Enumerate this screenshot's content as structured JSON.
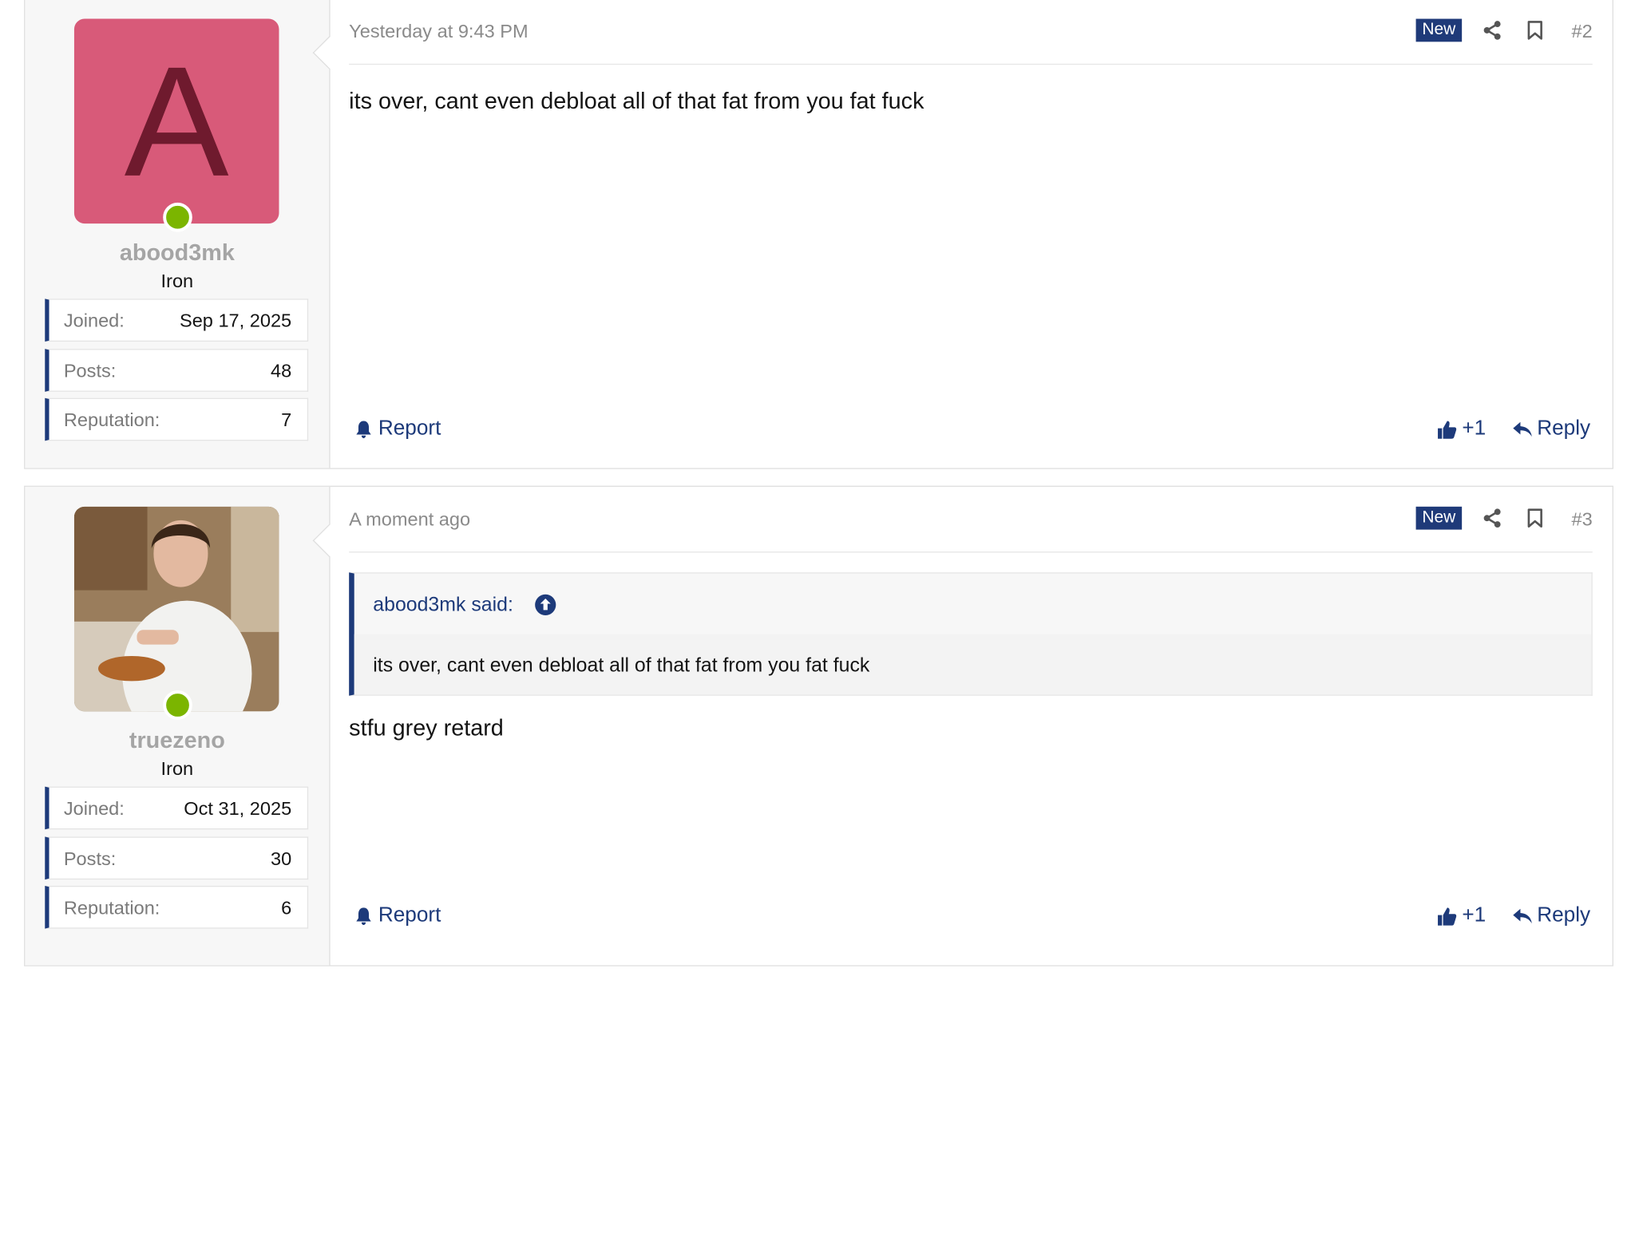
{
  "posts": [
    {
      "author": {
        "username": "abood3mk",
        "avatar_letter": "A",
        "avatar_color": "#d85a79",
        "rank": "Iron",
        "online": true,
        "stats": [
          {
            "label": "Joined:",
            "value": "Sep 17, 2025"
          },
          {
            "label": "Posts:",
            "value": "48"
          },
          {
            "label": "Reputation:",
            "value": "7"
          }
        ]
      },
      "date": "Yesterday at 9:43 PM",
      "badge": "New",
      "number": "#2",
      "body": "its over, cant even debloat all of that fat from you fat fuck",
      "actions": {
        "report": "Report",
        "like": "+1",
        "reply": "Reply"
      }
    },
    {
      "author": {
        "username": "truezeno",
        "avatar_type": "photo",
        "rank": "Iron",
        "online": true,
        "stats": [
          {
            "label": "Joined:",
            "value": "Oct 31, 2025"
          },
          {
            "label": "Posts:",
            "value": "30"
          },
          {
            "label": "Reputation:",
            "value": "6"
          }
        ]
      },
      "date": "A moment ago",
      "badge": "New",
      "number": "#3",
      "quote": {
        "author_line": "abood3mk said:",
        "text": "its over, cant even debloat all of that fat from you fat fuck"
      },
      "body": "stfu grey retard",
      "actions": {
        "report": "Report",
        "like": "+1",
        "reply": "Reply"
      }
    }
  ],
  "colors": {
    "accent": "#1d3a7a",
    "badge": "#1f3a79",
    "online": "#7bb500",
    "muted": "#8a8a8a"
  },
  "icons": {
    "share": "share-icon",
    "bookmark": "bookmark-icon",
    "report": "bell-icon",
    "like": "thumbs-up-icon",
    "reply": "reply-arrow-icon",
    "quote_jump": "arrow-up-circle-icon"
  }
}
